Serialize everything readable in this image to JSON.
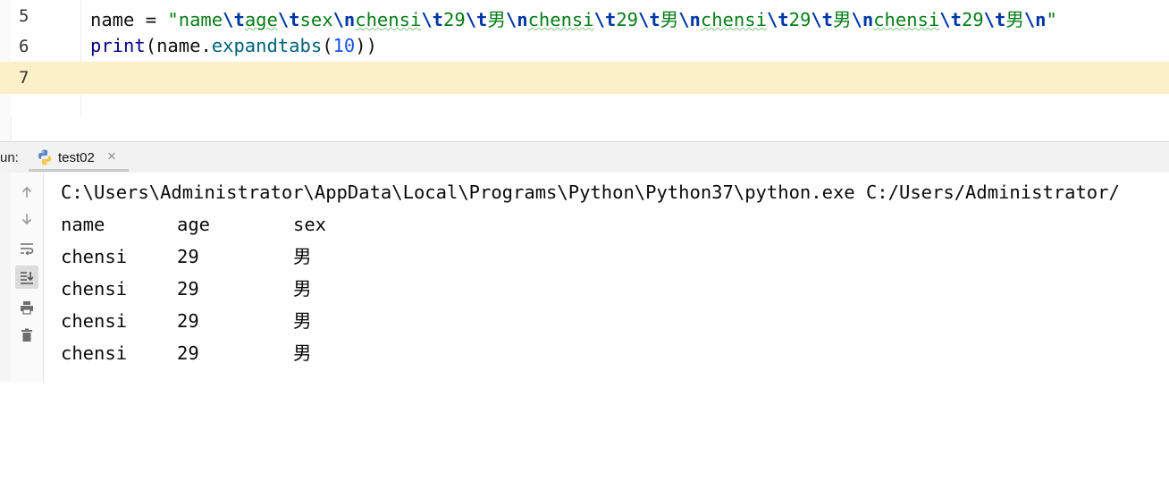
{
  "editor": {
    "lines": [
      {
        "number": "5",
        "tokens": [
          {
            "t": "name",
            "k": "ident"
          },
          {
            "t": " = ",
            "k": "op"
          },
          {
            "t": "\"name",
            "k": "str"
          },
          {
            "t": "\\t",
            "k": "esc"
          },
          {
            "t": "age",
            "k": "str",
            "sq": true
          },
          {
            "t": "\\t",
            "k": "esc"
          },
          {
            "t": "sex",
            "k": "str"
          },
          {
            "t": "\\n",
            "k": "esc"
          },
          {
            "t": "chensi",
            "k": "str",
            "sq": true
          },
          {
            "t": "\\t",
            "k": "esc"
          },
          {
            "t": "29",
            "k": "str"
          },
          {
            "t": "\\t",
            "k": "esc"
          },
          {
            "t": "男",
            "k": "str"
          },
          {
            "t": "\\n",
            "k": "esc"
          },
          {
            "t": "chensi",
            "k": "str",
            "sq": true
          },
          {
            "t": "\\t",
            "k": "esc"
          },
          {
            "t": "29",
            "k": "str"
          },
          {
            "t": "\\t",
            "k": "esc"
          },
          {
            "t": "男",
            "k": "str"
          },
          {
            "t": "\\n",
            "k": "esc"
          },
          {
            "t": "chensi",
            "k": "str",
            "sq": true
          },
          {
            "t": "\\t",
            "k": "esc"
          },
          {
            "t": "29",
            "k": "str"
          },
          {
            "t": "\\t",
            "k": "esc"
          },
          {
            "t": "男",
            "k": "str"
          },
          {
            "t": "\\n",
            "k": "esc"
          },
          {
            "t": "chensi",
            "k": "str",
            "sq": true
          },
          {
            "t": "\\t",
            "k": "esc"
          },
          {
            "t": "29",
            "k": "str"
          },
          {
            "t": "\\t",
            "k": "esc"
          },
          {
            "t": "男",
            "k": "str"
          },
          {
            "t": "\\n",
            "k": "esc"
          },
          {
            "t": "\"",
            "k": "str"
          }
        ]
      },
      {
        "number": "6",
        "tokens": [
          {
            "t": "print",
            "k": "builtin"
          },
          {
            "t": "(",
            "k": "paren"
          },
          {
            "t": "name",
            "k": "ident"
          },
          {
            "t": ".",
            "k": "op"
          },
          {
            "t": "expandtabs",
            "k": "method"
          },
          {
            "t": "(",
            "k": "paren"
          },
          {
            "t": "10",
            "k": "num"
          },
          {
            "t": "))",
            "k": "paren"
          }
        ]
      },
      {
        "number": "7",
        "tokens": []
      }
    ]
  },
  "run_panel": {
    "label": "un:",
    "tab": {
      "label": "test02",
      "close": "×",
      "icon": "python-icon"
    },
    "toolbar": [
      {
        "name": "scroll-up-icon"
      },
      {
        "name": "scroll-down-icon"
      },
      {
        "name": "soft-wrap-icon"
      },
      {
        "name": "scroll-to-end-icon"
      },
      {
        "name": "print-icon"
      },
      {
        "name": "trash-icon"
      }
    ],
    "console": {
      "command": "C:\\Users\\Administrator\\AppData\\Local\\Programs\\Python\\Python37\\python.exe C:/Users/Administrator/",
      "rows": [
        [
          "name",
          "age",
          "sex"
        ],
        [
          "chensi",
          "29",
          "男"
        ],
        [
          "chensi",
          "29",
          "男"
        ],
        [
          "chensi",
          "29",
          "男"
        ],
        [
          "chensi",
          "29",
          "男"
        ]
      ]
    }
  },
  "colors": {
    "current_line": "#fcf0c9",
    "string": "#067d17",
    "escape": "#0037a6",
    "builtin": "#000080",
    "method": "#00627a",
    "number": "#1750eb"
  }
}
